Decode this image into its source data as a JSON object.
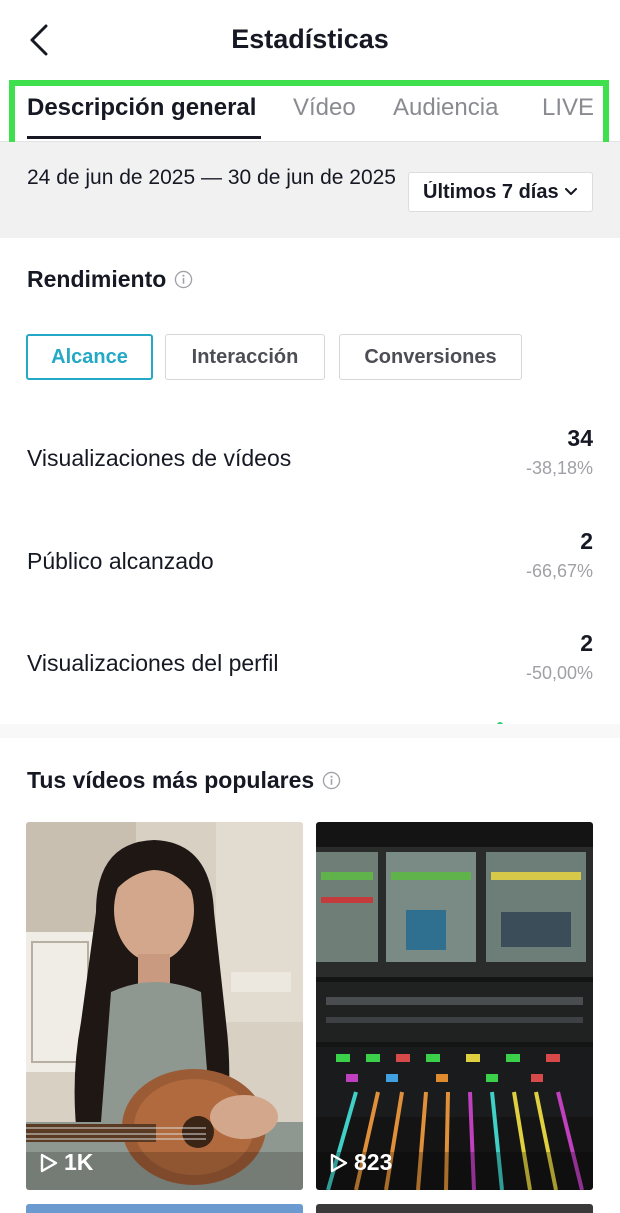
{
  "header": {
    "title": "Estadísticas"
  },
  "tabs": [
    {
      "label": "Descripción general"
    },
    {
      "label": "Vídeo"
    },
    {
      "label": "Audiencia"
    },
    {
      "label": "LIVE"
    }
  ],
  "date_bar": {
    "range": "24 de jun de 2025 — 30 de jun de 2025",
    "period": "Últimos 7 días"
  },
  "performance": {
    "title": "Rendimiento",
    "chips": [
      {
        "label": "Alcance"
      },
      {
        "label": "Interacción"
      },
      {
        "label": "Conversiones"
      }
    ],
    "metrics": [
      {
        "label": "Visualizaciones de vídeos",
        "value": "34",
        "change": "-38,18%"
      },
      {
        "label": "Público alcanzado",
        "value": "2",
        "change": "-66,67%"
      },
      {
        "label": "Visualizaciones del perfil",
        "value": "2",
        "change": "-50,00%"
      }
    ]
  },
  "popular": {
    "title": "Tus vídeos más populares",
    "videos": [
      {
        "views": "1K",
        "thumbnail": "person-playing-ukulele"
      },
      {
        "views": "823",
        "thumbnail": "audio-mixing-console"
      }
    ]
  },
  "colors": {
    "accent": "#23a9c6",
    "highlight": "#3fe04d",
    "text": "#161823",
    "muted": "#8a8b91"
  }
}
